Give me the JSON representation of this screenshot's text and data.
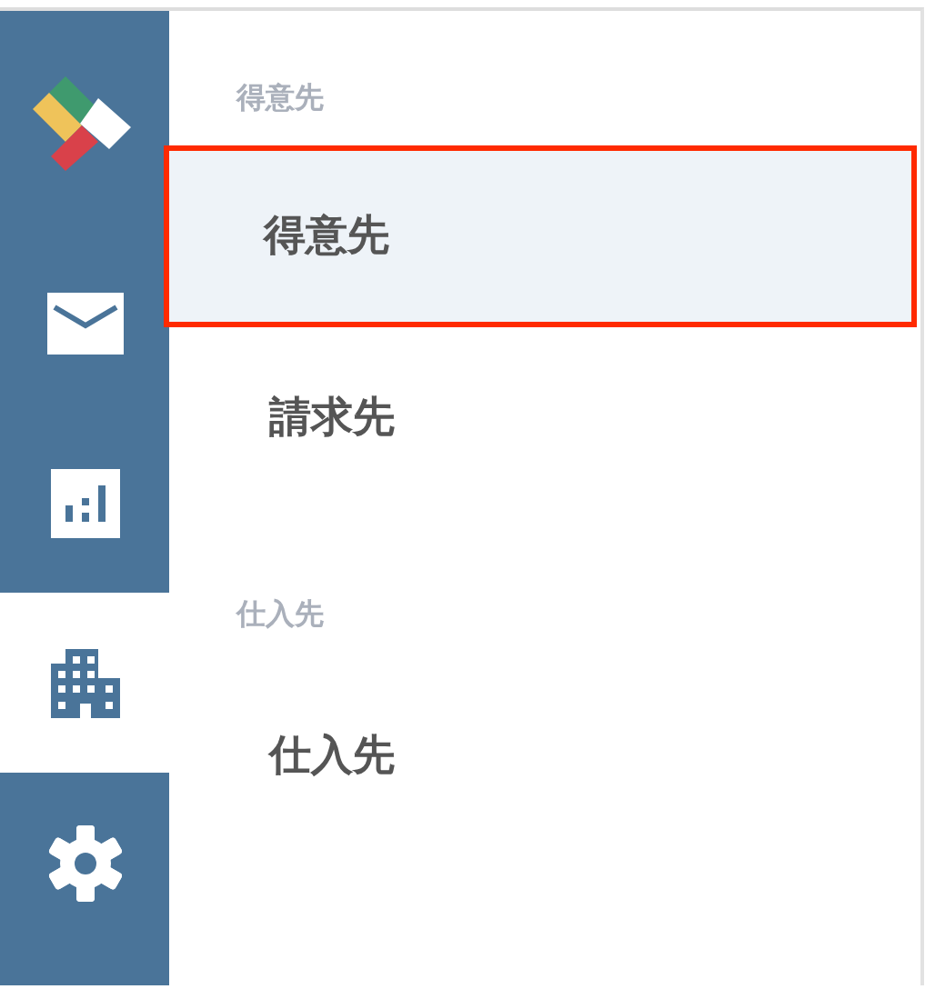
{
  "sidebar": {
    "items": [
      {
        "kind": "mail",
        "selected": false
      },
      {
        "kind": "chart",
        "selected": false
      },
      {
        "kind": "building",
        "selected": true
      },
      {
        "kind": "settings",
        "selected": false
      }
    ]
  },
  "menu": {
    "sections": [
      {
        "title": "得意先",
        "items": [
          {
            "label": "得意先",
            "selected": true,
            "outlined": true
          },
          {
            "label": "請求先",
            "selected": false,
            "outlined": false
          }
        ]
      },
      {
        "title": "仕入先",
        "items": [
          {
            "label": "仕入先",
            "selected": false,
            "outlined": false
          }
        ]
      }
    ]
  }
}
